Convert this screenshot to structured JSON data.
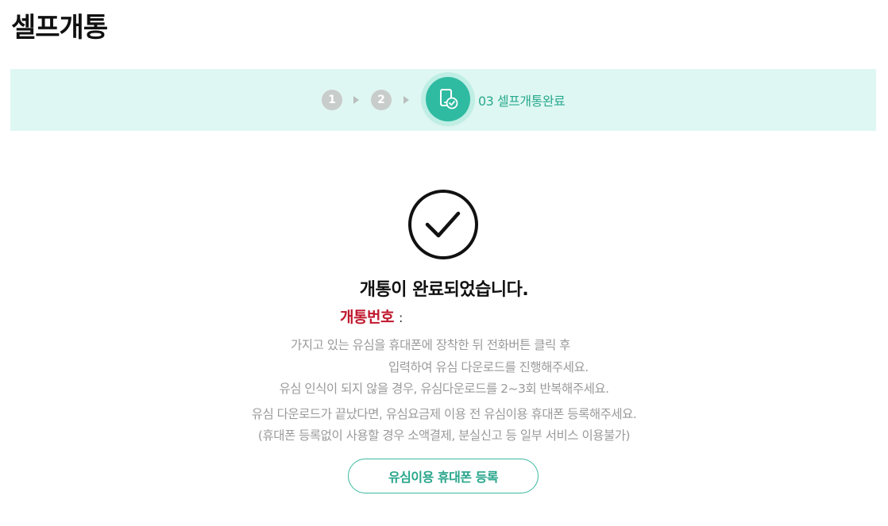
{
  "page": {
    "title": "셀프개통"
  },
  "steps": {
    "items": [
      {
        "label": "1",
        "state": "done"
      },
      {
        "label": "2",
        "state": "done"
      }
    ],
    "current": {
      "label": "03 셀프개통완료",
      "icon": "phone-check-icon"
    }
  },
  "result": {
    "icon": "checkmark-circle-icon",
    "title": "개통이 완료되었습니다.",
    "number_label": "개통번호",
    "number_separator": ":",
    "number_value": ""
  },
  "instructions": {
    "line1": "가지고 있는 유심을 휴대폰에 장착한 뒤 전화버튼 클릭 후",
    "line2": "입력하여 유심 다운로드를 진행해주세요.",
    "line3": "유심 인식이 되지 않을 경우, 유심다운로드를 2~3회 반복해주세요.",
    "line4": "유심 다운로드가 끝났다면, 유심요금제 이용 전 유심이용 휴대폰 등록해주세요.",
    "line5": "(휴대폰 등록없이 사용할 경우 소액결제, 분실신고 등 일부 서비스 이용불가)"
  },
  "actions": {
    "register_label": "유심이용 휴대폰 등록"
  },
  "colors": {
    "accent": "#2fbba2",
    "accent_text": "#27a58b",
    "step_bar_bg": "#dff7f2",
    "number_label": "#c0172d",
    "muted_text": "#9a9a9a"
  }
}
